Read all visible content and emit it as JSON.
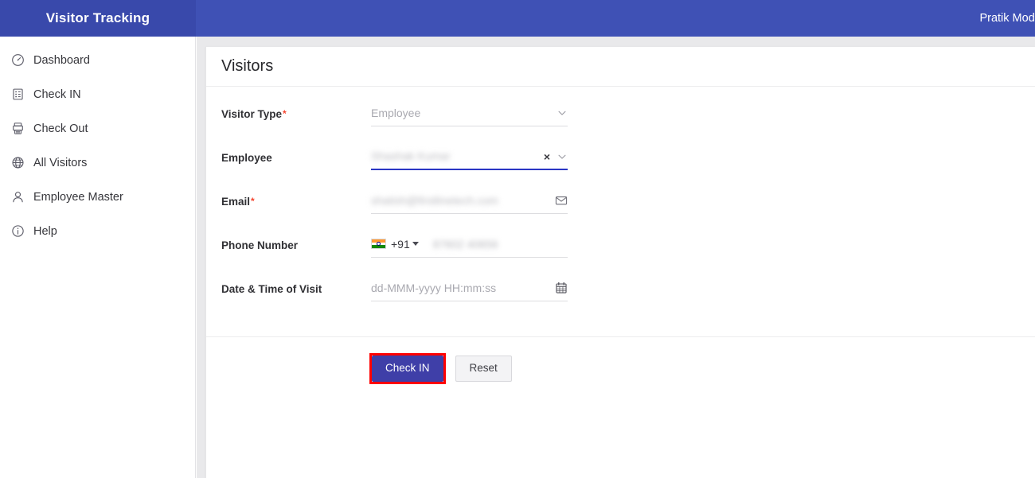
{
  "topbar": {
    "brand": "Visitor Tracking",
    "user": "Pratik Modi"
  },
  "sidebar": {
    "items": [
      {
        "label": "Dashboard",
        "icon": "dashboard-icon"
      },
      {
        "label": "Check IN",
        "icon": "clipboard-icon"
      },
      {
        "label": "Check Out",
        "icon": "receipt-printer-icon"
      },
      {
        "label": "All Visitors",
        "icon": "globe-icon"
      },
      {
        "label": "Employee Master",
        "icon": "person-icon"
      },
      {
        "label": "Help",
        "icon": "info-circle-icon"
      }
    ]
  },
  "card": {
    "title": "Visitors",
    "fields": {
      "visitor_type": {
        "label": "Visitor Type",
        "required": true,
        "value": "Employee",
        "state": "placeholder"
      },
      "employee": {
        "label": "Employee",
        "required": false,
        "value": "Shashak Kumar",
        "state": "redacted",
        "focused": true,
        "clear_icon": "×"
      },
      "email": {
        "label": "Email",
        "required": true,
        "value": "shatish@firstlinetech.com",
        "state": "redacted",
        "icon": "envelope-icon"
      },
      "phone": {
        "label": "Phone Number",
        "required": false,
        "country_flag": "india-flag-icon",
        "dial_code": "+91",
        "value": "87602 40656",
        "state": "redacted"
      },
      "visit_datetime": {
        "label": "Date & Time of Visit",
        "required": false,
        "placeholder": "dd-MMM-yyyy HH:mm:ss",
        "icon": "calendar-icon"
      }
    },
    "actions": {
      "primary": "Check IN",
      "secondary": "Reset"
    }
  },
  "colors": {
    "brand_blue": "#3949ab",
    "topbar_blue": "#3f51b5",
    "primary_button": "#3f3fa8",
    "highlight_outline": "#ff0000",
    "focus_underline": "#2a36c4",
    "required_asterisk": "#f4442e"
  }
}
